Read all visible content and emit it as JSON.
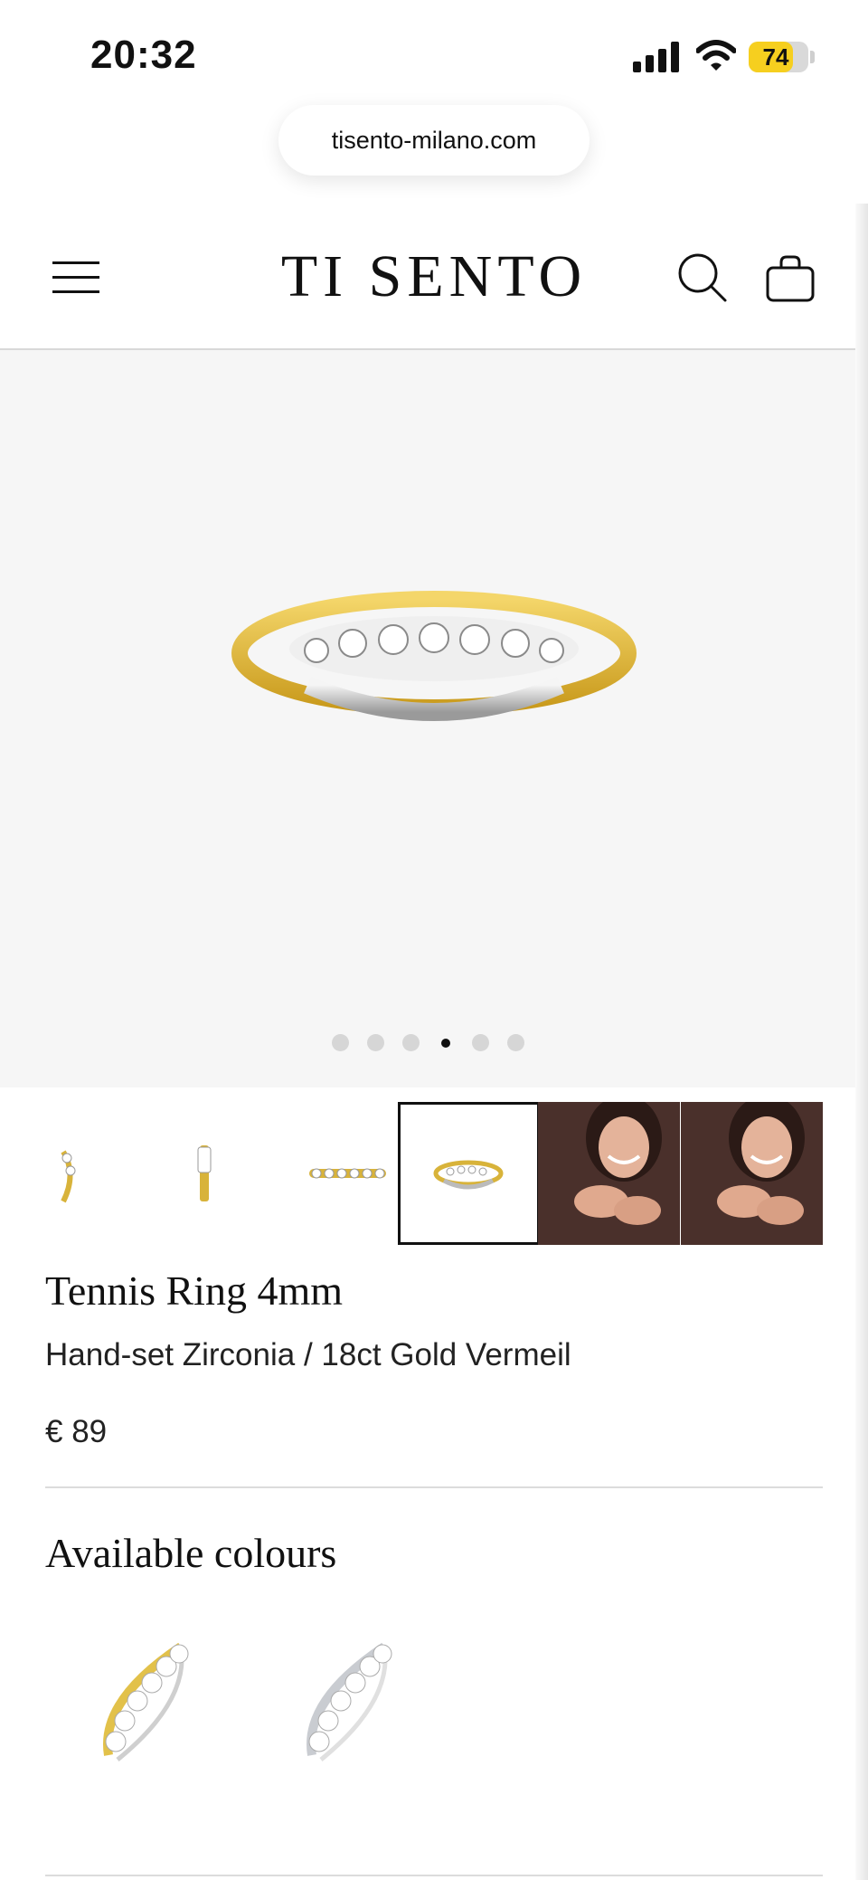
{
  "status_bar": {
    "time": "20:32",
    "battery_level": "74",
    "battery_percent": 74
  },
  "browser": {
    "url": "tisento-milano.com"
  },
  "header": {
    "logo": "TI SENTO"
  },
  "carousel": {
    "total_slides": 6,
    "active_slide": 4
  },
  "thumbnails": [
    {
      "type": "ring-side",
      "selected": false
    },
    {
      "type": "ring-profile",
      "selected": false
    },
    {
      "type": "ring-top",
      "selected": false
    },
    {
      "type": "ring-front",
      "selected": true
    },
    {
      "type": "model-photo",
      "selected": false
    },
    {
      "type": "model-photo",
      "selected": false
    }
  ],
  "product": {
    "title": "Tennis Ring 4mm",
    "subtitle": "Hand-set Zirconia / 18ct Gold Vermeil",
    "price": "€ 89"
  },
  "colours": {
    "heading": "Available colours",
    "options": [
      {
        "variant": "gold",
        "color": "#e2c14a"
      },
      {
        "variant": "silver",
        "color": "#c9ccd1"
      }
    ]
  },
  "colors": {
    "battery": "#f6cf1f",
    "hero_bg": "#f6f6f6",
    "text": "#111111"
  }
}
